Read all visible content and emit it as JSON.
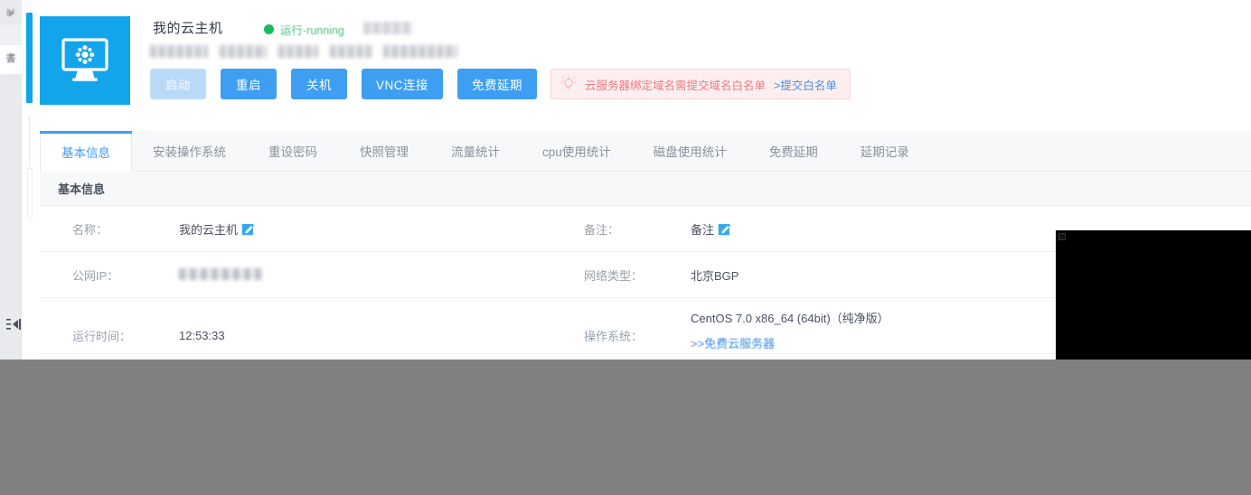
{
  "sidebar": {
    "icons": [
      "menu-glyph-1",
      "menu-glyph-2"
    ],
    "collapse_label": "collapse-sidebar"
  },
  "header": {
    "host_icon": "monitor-gear-icon",
    "title": "我的云主机",
    "status_text": "运行-running",
    "status_dot_color": "#19bd5c",
    "status_badge_redacted": true,
    "redacted_info_line": [
      "",
      "",
      "",
      "",
      ""
    ],
    "buttons": [
      {
        "label": "启动",
        "name": "start-button",
        "disabled": true
      },
      {
        "label": "重启",
        "name": "restart-button",
        "disabled": false
      },
      {
        "label": "关机",
        "name": "shutdown-button",
        "disabled": false
      },
      {
        "label": "VNC连接",
        "name": "vnc-connect-button",
        "disabled": false
      },
      {
        "label": "免费延期",
        "name": "free-extend-button",
        "disabled": false
      }
    ],
    "alert": {
      "icon": "lightbulb-icon",
      "text": "云服务器绑定域名需提交域名白名单",
      "link": ">提交白名单",
      "bg_color": "#fdeff0",
      "text_color": "#f0787f",
      "link_color": "#4b8fe0"
    }
  },
  "tabs": [
    {
      "label": "基本信息",
      "name": "tab-basic-info",
      "active": true
    },
    {
      "label": "安装操作系统",
      "name": "tab-install-os",
      "active": false
    },
    {
      "label": "重设密码",
      "name": "tab-reset-password",
      "active": false
    },
    {
      "label": "快照管理",
      "name": "tab-snapshot-manage",
      "active": false
    },
    {
      "label": "流量统计",
      "name": "tab-traffic-stats",
      "active": false
    },
    {
      "label": "cpu使用统计",
      "name": "tab-cpu-stats",
      "active": false
    },
    {
      "label": "磁盘使用统计",
      "name": "tab-disk-stats",
      "active": false
    },
    {
      "label": "免费延期",
      "name": "tab-free-extend",
      "active": false
    },
    {
      "label": "延期记录",
      "name": "tab-extend-records",
      "active": false
    }
  ],
  "panel": {
    "section_title": "基本信息",
    "rows": [
      {
        "left_label": "名称：",
        "left_value": "我的云主机",
        "left_has_edit": true,
        "right_label": "备注：",
        "right_value": "备注",
        "right_has_edit": true
      },
      {
        "left_label": "公网IP：",
        "left_value": "",
        "left_redacted": true,
        "right_label": "网络类型：",
        "right_value": "北京BGP",
        "right_has_edit": false
      },
      {
        "left_label": "运行时间：",
        "left_value": "12:53:33",
        "right_label": "操作系统：",
        "right_value": "CentOS 7.0 x86_64 (64bit)（纯净版）",
        "right_link": ">>免费云服务器",
        "right_has_edit": false
      }
    ]
  },
  "overlays": {
    "black_panel": "black-overlay-panel",
    "gray_band": "gray-footer-band",
    "gray_color": "#808080"
  },
  "theme": {
    "accent": "#3d9ef2",
    "host_icon_bg": "#12a5ec",
    "status_green": "#4fbd7e"
  }
}
